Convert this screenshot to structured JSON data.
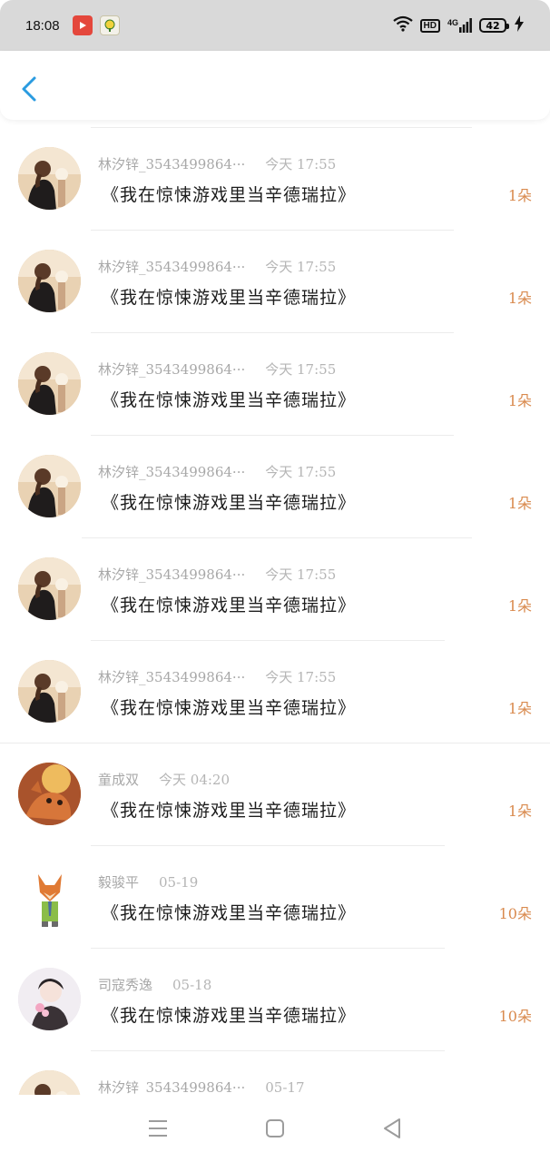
{
  "status_bar": {
    "time": "18:08",
    "network": "4G",
    "hd": "HD",
    "battery": "42"
  },
  "nav": {
    "back_icon": "chevron-left-icon",
    "accent": "#2a9be0"
  },
  "list": [
    {
      "name": "林汐锌_3543499864···",
      "time": "今天 17:55",
      "title": "《我在惊悚游戏里当辛德瑞拉》",
      "count": "1朵",
      "avatar": "girl"
    },
    {
      "name": "林汐锌_3543499864···",
      "time": "今天 17:55",
      "title": "《我在惊悚游戏里当辛德瑞拉》",
      "count": "1朵",
      "avatar": "girl"
    },
    {
      "name": "林汐锌_3543499864···",
      "time": "今天 17:55",
      "title": "《我在惊悚游戏里当辛德瑞拉》",
      "count": "1朵",
      "avatar": "girl"
    },
    {
      "name": "林汐锌_3543499864···",
      "time": "今天 17:55",
      "title": "《我在惊悚游戏里当辛德瑞拉》",
      "count": "1朵",
      "avatar": "girl"
    },
    {
      "name": "林汐锌_3543499864···",
      "time": "今天 17:55",
      "title": "《我在惊悚游戏里当辛德瑞拉》",
      "count": "1朵",
      "avatar": "girl"
    },
    {
      "name": "林汐锌_3543499864···",
      "time": "今天 17:55",
      "title": "《我在惊悚游戏里当辛德瑞拉》",
      "count": "1朵",
      "avatar": "girl"
    },
    {
      "name": "童成双",
      "time": "今天 04:20",
      "title": "《我在惊悚游戏里当辛德瑞拉》",
      "count": "1朵",
      "avatar": "cat"
    },
    {
      "name": "毅骏平",
      "time": "05-19",
      "title": "《我在惊悚游戏里当辛德瑞拉》",
      "count": "10朵",
      "avatar": "fox"
    },
    {
      "name": "司寇秀逸",
      "time": "05-18",
      "title": "《我在惊悚游戏里当辛德瑞拉》",
      "count": "10朵",
      "avatar": "lady"
    },
    {
      "name": "林汐锌_3543499864···",
      "time": "05-17",
      "title": "",
      "count": "",
      "avatar": "girl"
    }
  ],
  "system_nav": {
    "menu_icon": "menu-icon",
    "home_icon": "home-square-icon",
    "back_icon": "back-triangle-icon"
  },
  "colors": {
    "count": "#d98a4e",
    "meta": "#a8a8a8",
    "title": "#1d1d1d"
  }
}
